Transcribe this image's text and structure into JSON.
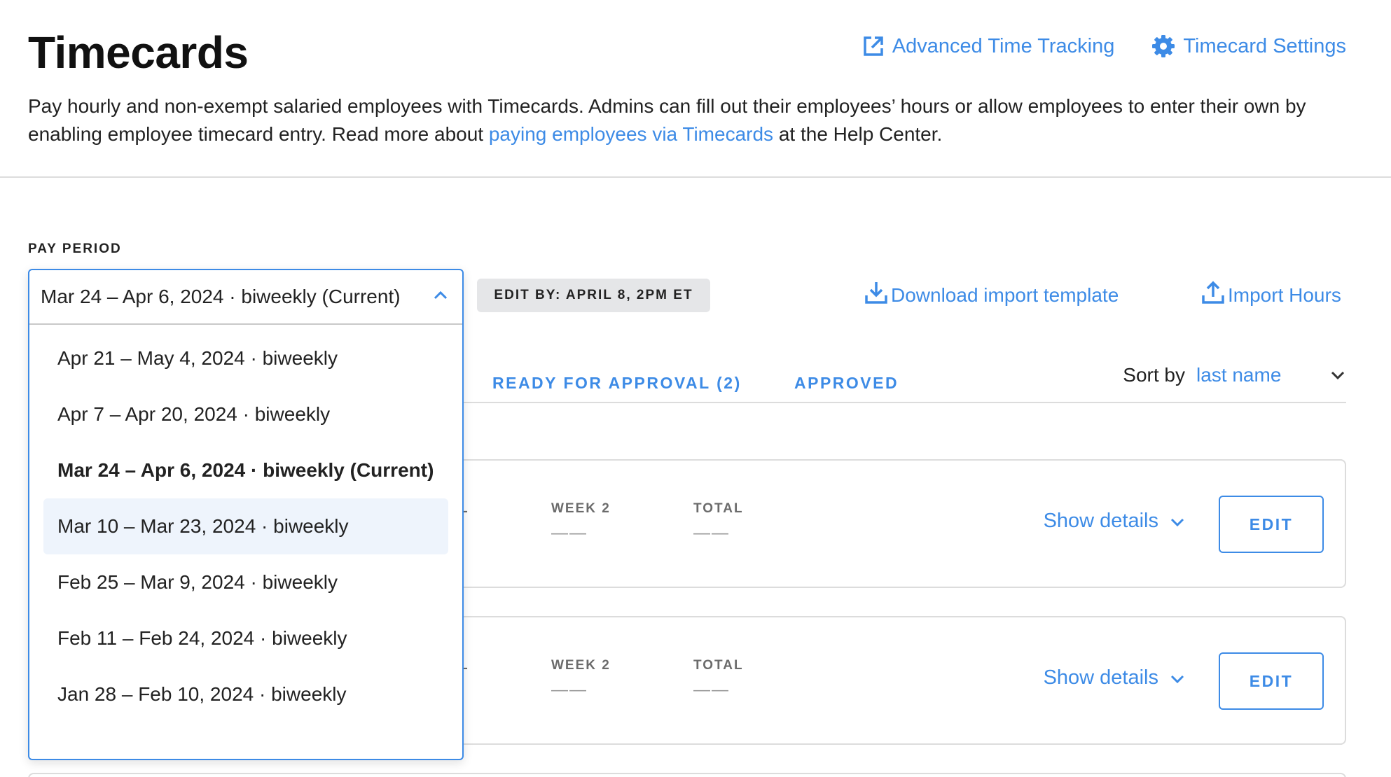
{
  "header": {
    "title": "Timecards",
    "links": {
      "advanced": "Advanced Time Tracking",
      "settings": "Timecard Settings"
    },
    "description": {
      "before": "Pay hourly and non-exempt salaried employees with Timecards. Admins can fill out their employees’ hours or allow employees to enter their own by enabling employee timecard entry. Read more about ",
      "link": "paying employees via Timecards",
      "after": " at the Help Center."
    }
  },
  "pay_period": {
    "label": "PAY PERIOD",
    "selected": "Mar 24 – Apr 6, 2024 · biweekly (Current)",
    "options": [
      "Apr 21 – May 4, 2024 · biweekly",
      "Apr 7 – Apr 20, 2024 · biweekly",
      "Mar 24 – Apr 6, 2024 · biweekly (Current)",
      "Mar 10 – Mar 23, 2024 · biweekly",
      "Feb 25 – Mar 9, 2024 · biweekly",
      "Feb 11 – Feb 24, 2024 · biweekly",
      "Jan 28 – Feb 10, 2024 · biweekly"
    ]
  },
  "edit_by": "EDIT BY: APRIL 8, 2PM ET",
  "actions": {
    "download": "Download import template",
    "import": "Import Hours"
  },
  "tabs": {
    "ready": "READY FOR APPROVAL (2)",
    "approved": "APPROVED"
  },
  "sort": {
    "label": "Sort by",
    "value": "last name"
  },
  "cards": [
    {
      "col_partial": "L",
      "week2_label": "WEEK 2",
      "week2_value": "——",
      "total_label": "TOTAL",
      "total_value": "——",
      "details": "Show details",
      "edit": "EDIT"
    },
    {
      "col_partial": "L",
      "week2_label": "WEEK 2",
      "week2_value": "——",
      "total_label": "TOTAL",
      "total_value": "——",
      "details": "Show details",
      "edit": "EDIT"
    }
  ],
  "colors": {
    "accent": "#3d8be6",
    "badge_bg": "#e5e6e8",
    "hover_bg": "#eef4fc"
  }
}
